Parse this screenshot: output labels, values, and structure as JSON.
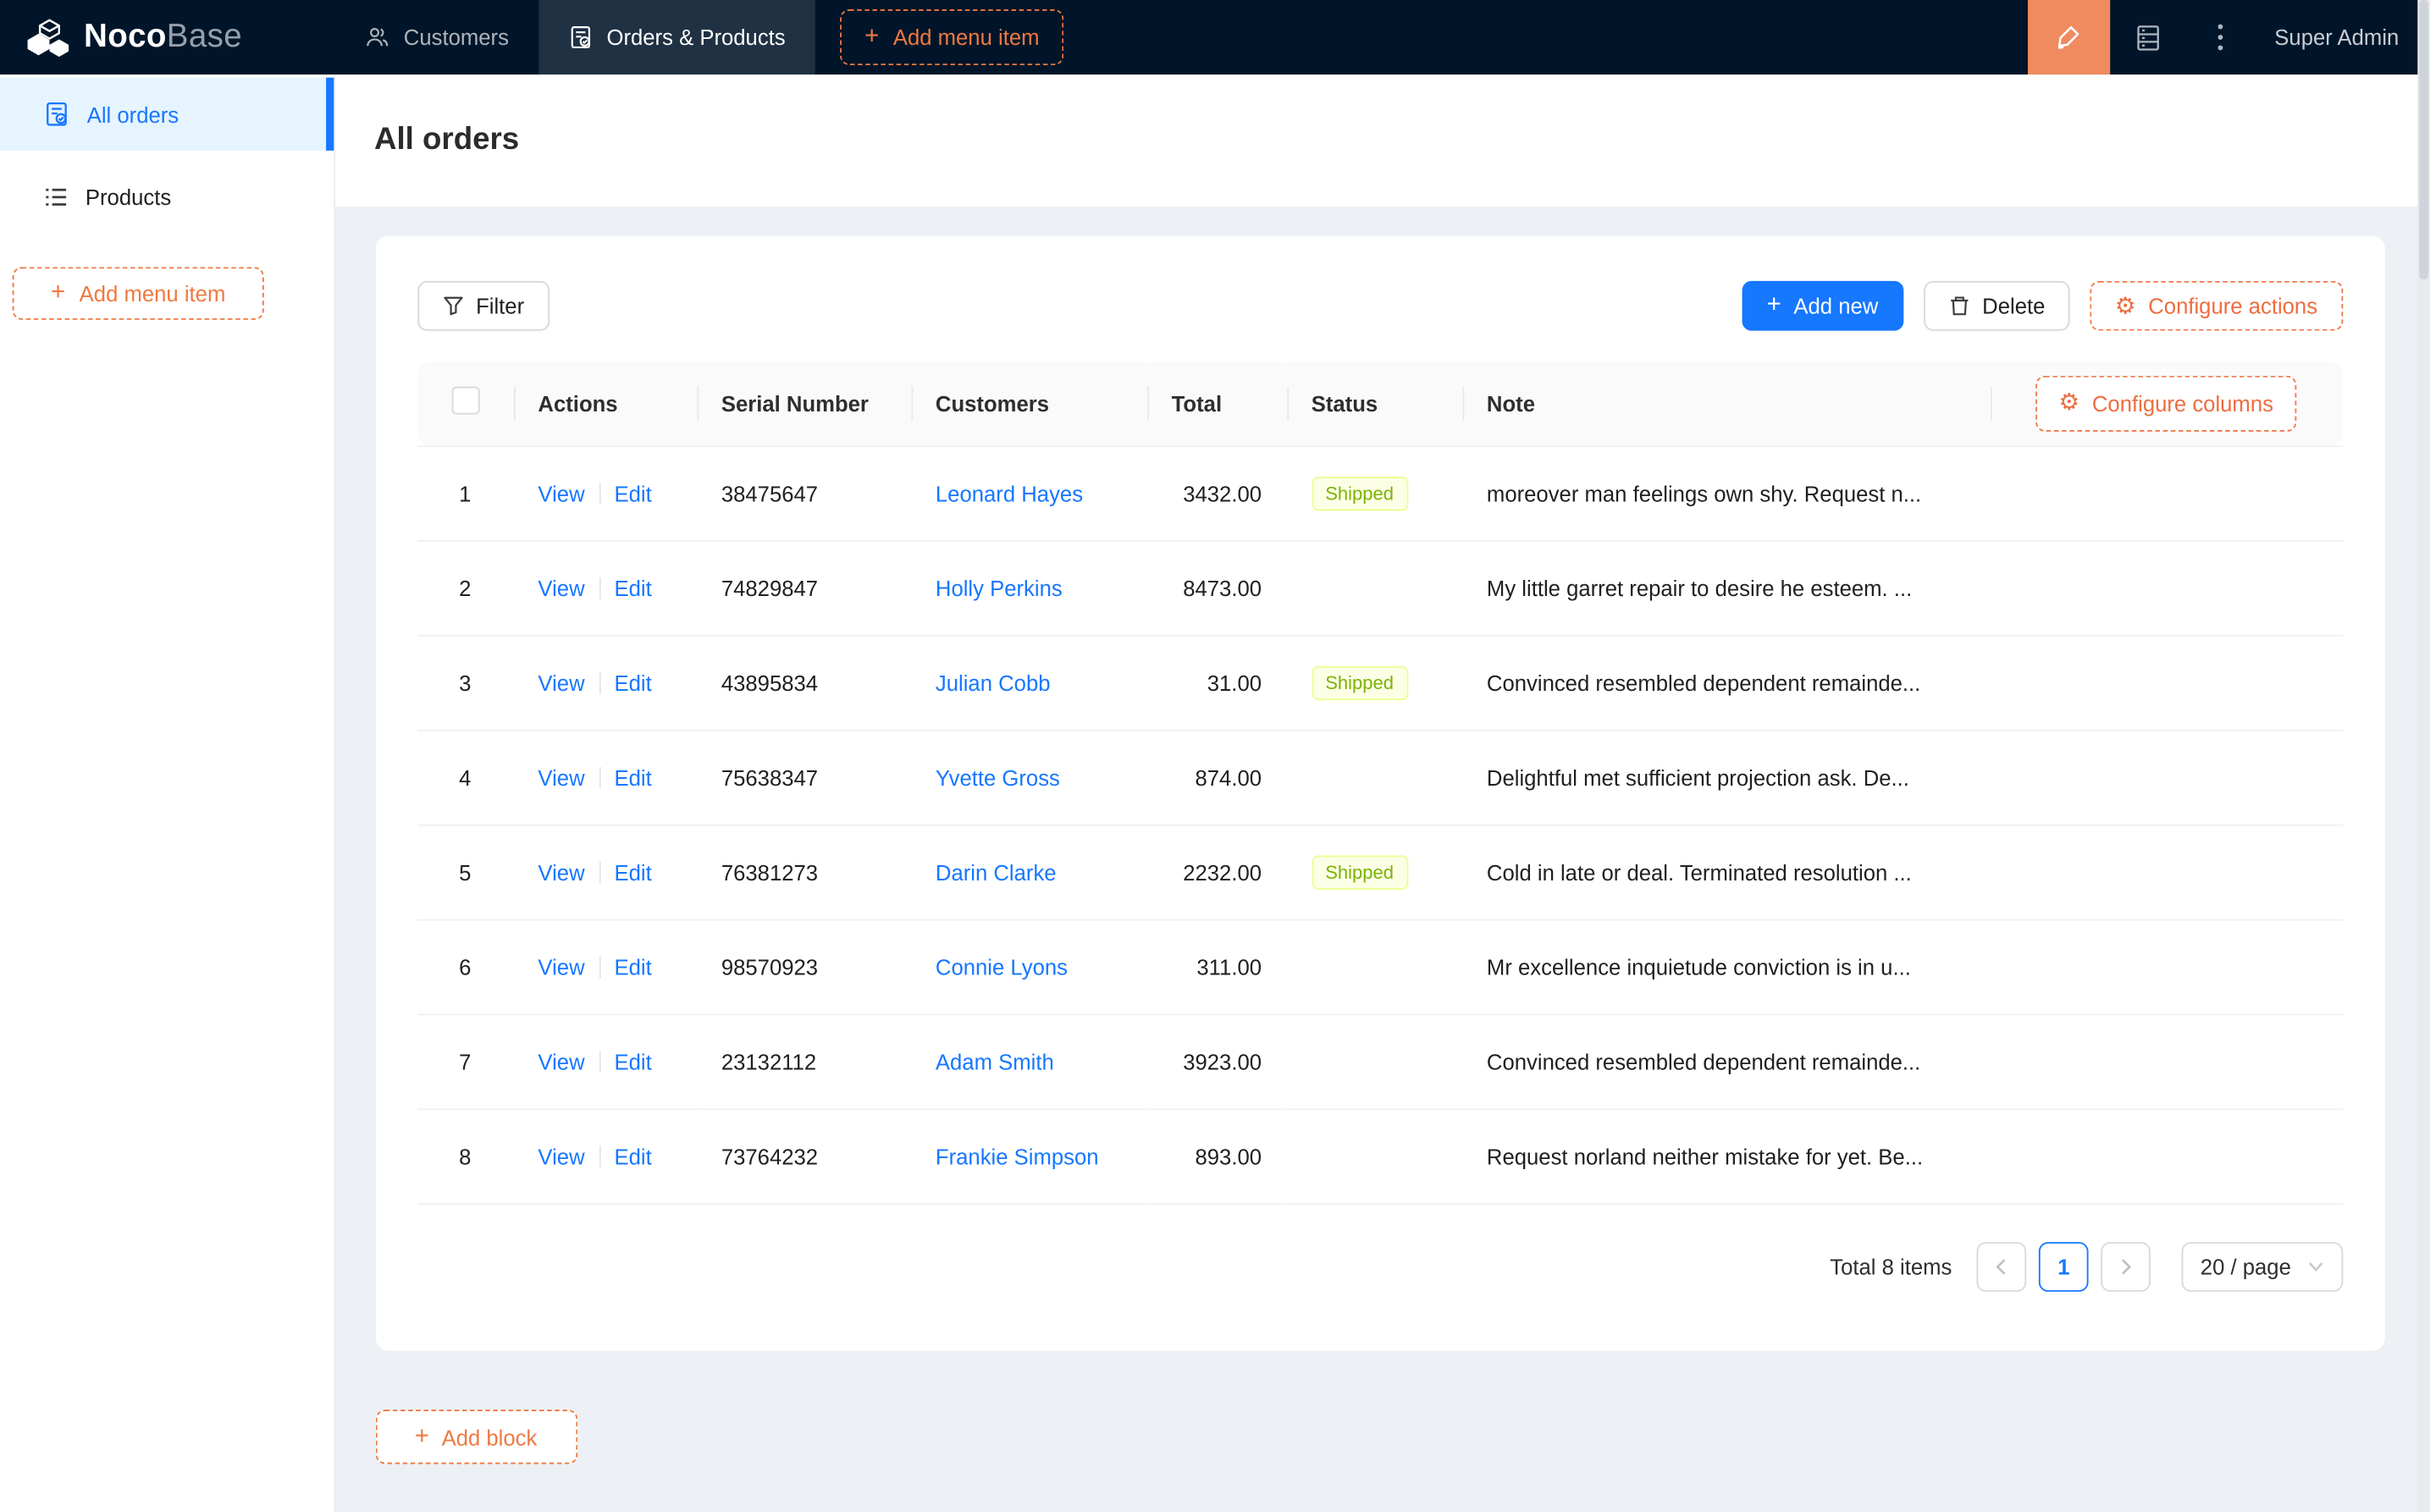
{
  "navbar": {
    "logo": {
      "bold": "Noco",
      "light": "Base"
    },
    "items": [
      {
        "label": "Customers",
        "icon": "customers-icon",
        "active": false
      },
      {
        "label": "Orders & Products",
        "icon": "orders-icon",
        "active": true
      }
    ],
    "add_menu_item_label": "Add menu item",
    "right": {
      "designer_icon": "highlighter-icon",
      "plugins_icon": "database-icon",
      "more_icon": "kebab-icon",
      "user": "Super Admin"
    }
  },
  "sidebar": {
    "items": [
      {
        "label": "All orders",
        "icon": "orders-form-icon",
        "active": true
      },
      {
        "label": "Products",
        "icon": "list-icon",
        "active": false
      }
    ],
    "add_menu_item_label": "Add menu item"
  },
  "page": {
    "title": "All orders"
  },
  "toolbar": {
    "filter_label": "Filter",
    "add_new_label": "Add new",
    "delete_label": "Delete",
    "configure_actions_label": "Configure actions"
  },
  "table": {
    "configure_columns_label": "Configure columns",
    "columns": [
      "Actions",
      "Serial Number",
      "Customers",
      "Total",
      "Status",
      "Note"
    ],
    "actions": {
      "view": "View",
      "edit": "Edit"
    },
    "rows": [
      {
        "index": "1",
        "serial": "38475647",
        "customer": "Leonard Hayes",
        "total": "3432.00",
        "status": "Shipped",
        "note": "moreover man feelings own shy. Request n..."
      },
      {
        "index": "2",
        "serial": "74829847",
        "customer": "Holly Perkins",
        "total": "8473.00",
        "status": "",
        "note": "My little garret repair to desire he esteem. ..."
      },
      {
        "index": "3",
        "serial": "43895834",
        "customer": "Julian Cobb",
        "total": "31.00",
        "status": "Shipped",
        "note": "Convinced resembled dependent remainde..."
      },
      {
        "index": "4",
        "serial": "75638347",
        "customer": "Yvette Gross",
        "total": "874.00",
        "status": "",
        "note": "Delightful met sufficient projection ask. De..."
      },
      {
        "index": "5",
        "serial": "76381273",
        "customer": "Darin Clarke",
        "total": "2232.00",
        "status": "Shipped",
        "note": "Cold in late or deal. Terminated resolution ..."
      },
      {
        "index": "6",
        "serial": "98570923",
        "customer": "Connie Lyons",
        "total": "311.00",
        "status": "",
        "note": "Mr excellence inquietude conviction is in u..."
      },
      {
        "index": "7",
        "serial": "23132112",
        "customer": "Adam Smith",
        "total": "3923.00",
        "status": "",
        "note": "Convinced resembled dependent remainde..."
      },
      {
        "index": "8",
        "serial": "73764232",
        "customer": "Frankie Simpson",
        "total": "893.00",
        "status": "",
        "note": "Request norland neither mistake for yet. Be..."
      }
    ]
  },
  "pagination": {
    "total_text": "Total 8 items",
    "current_page": "1",
    "page_size": "20 / page"
  },
  "footer": {
    "add_block_label": "Add block"
  },
  "colors": {
    "primary_blue": "#1677ff",
    "settings_orange": "#ee7941",
    "designer_button_orange": "#f08a5f",
    "navbar_bg": "#001529",
    "sidebar_active_bg": "#e6f4ff",
    "status_tag_bg": "#fcffe6",
    "status_tag_border": "#eaff8f",
    "status_tag_text": "#7cb305",
    "content_bg": "#edf0f4"
  }
}
